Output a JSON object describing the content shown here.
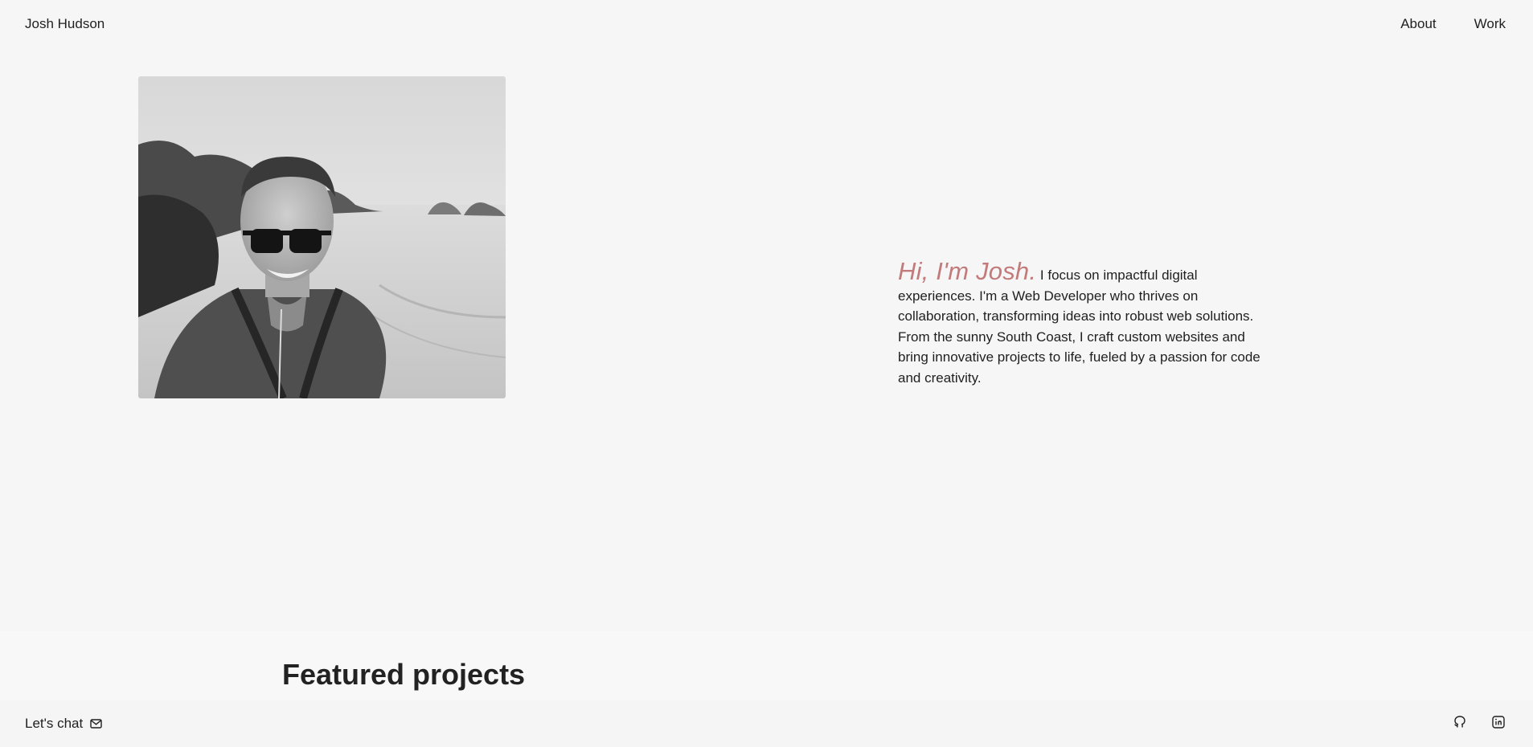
{
  "header": {
    "brand": "Josh Hudson",
    "nav": [
      {
        "label": "About"
      },
      {
        "label": "Work"
      }
    ]
  },
  "hero": {
    "greeting": "Hi, I'm Josh.",
    "bio": "I focus on impactful digital experiences. I'm a Web Developer who thrives on collaboration, transforming ideas into robust web solutions. From the sunny South Coast, I craft custom websites and bring innovative projects to life, fueled by a passion for code and creativity.",
    "accent_color": "#c27a7a",
    "photo_icon": "portrait-photo"
  },
  "featured": {
    "title": "Featured projects"
  },
  "footer": {
    "chat_label": "Let's chat",
    "chat_icon": "mail-icon",
    "social_icons": [
      "github-icon",
      "linkedin-icon"
    ]
  }
}
